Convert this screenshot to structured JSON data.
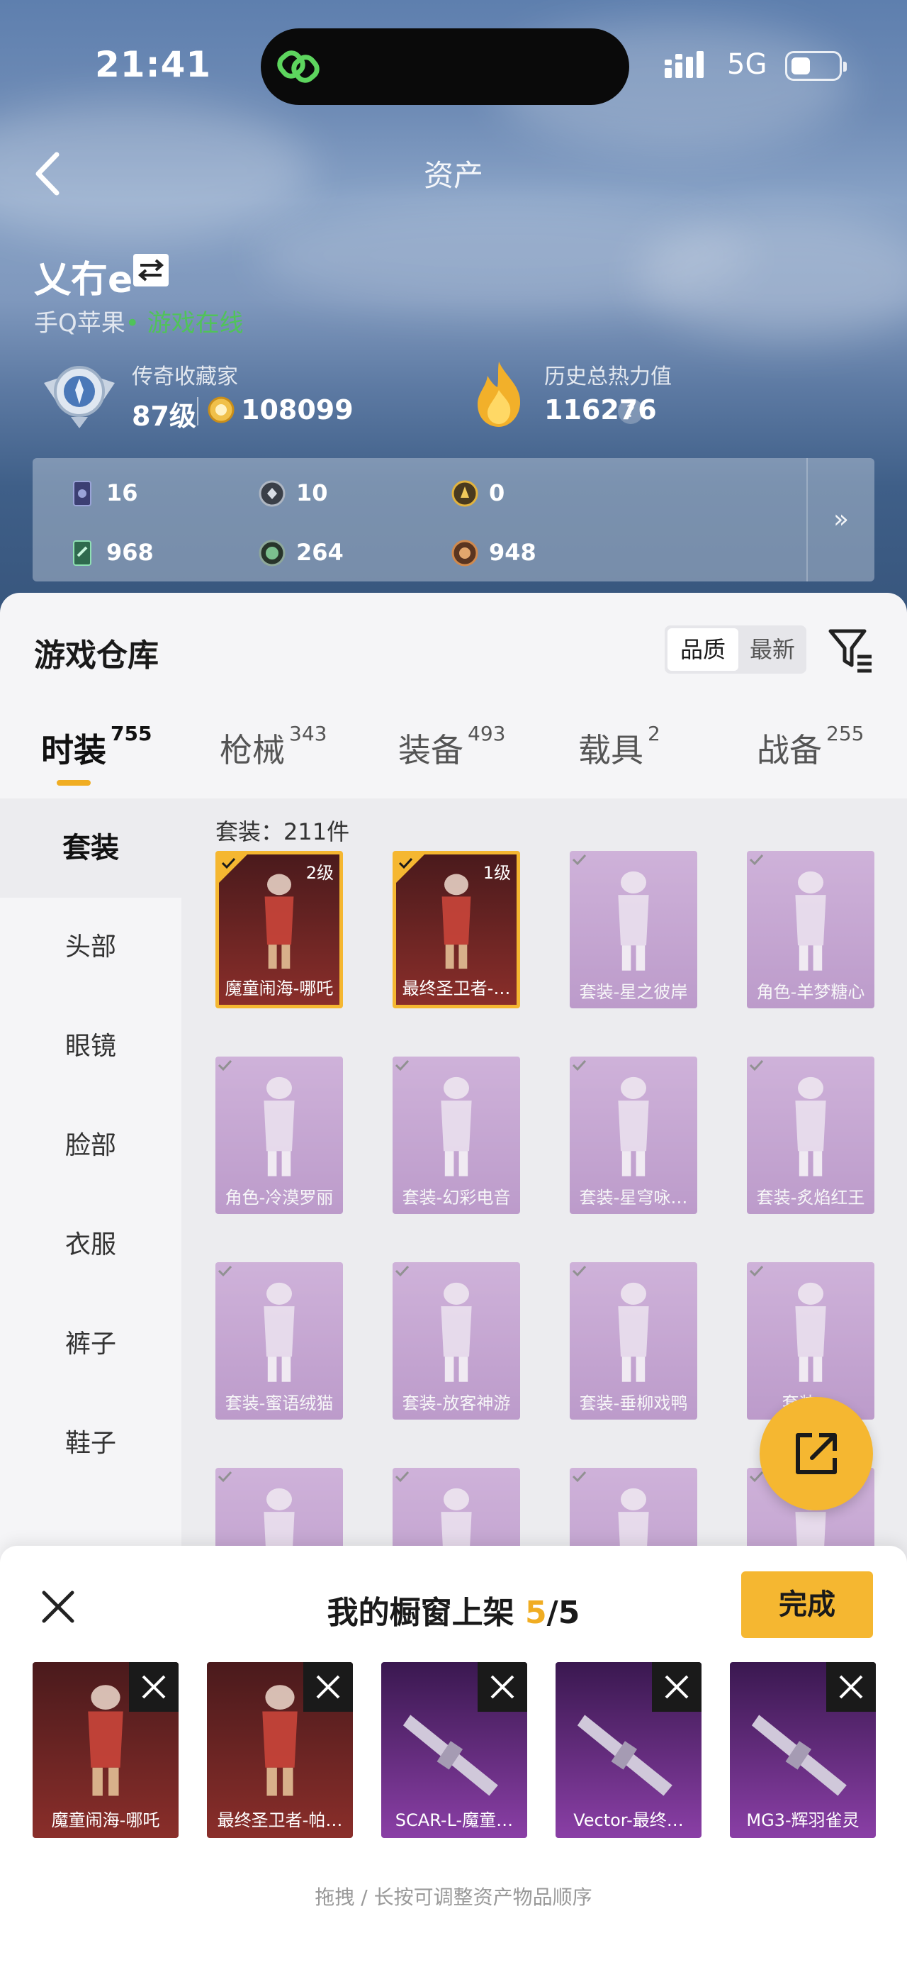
{
  "status_bar": {
    "time": "21:41",
    "network": "5G"
  },
  "header": {
    "title": "资产"
  },
  "profile": {
    "name": "乂冇e",
    "platform": "手Q苹果",
    "online_text": "• 游戏在线",
    "rank_label": "传奇收藏家",
    "level": "87级",
    "coins": "108099",
    "heat_label": "历史总热力值",
    "heat_value": "116276",
    "help": "?"
  },
  "stats": [
    {
      "icon": "card-icon",
      "value": "16"
    },
    {
      "icon": "silver-medal-icon",
      "value": "10"
    },
    {
      "icon": "gold-medal-icon",
      "value": "0"
    },
    {
      "icon": "voucher-icon",
      "value": "968"
    },
    {
      "icon": "orb-icon",
      "value": "264"
    },
    {
      "icon": "bronze-coin-icon",
      "value": "948"
    }
  ],
  "stats_more": "»",
  "warehouse": {
    "title": "游戏仓库",
    "sort": {
      "quality": "品质",
      "latest": "最新"
    },
    "tabs": [
      {
        "label": "时装",
        "count": "755"
      },
      {
        "label": "枪械",
        "count": "343"
      },
      {
        "label": "装备",
        "count": "493"
      },
      {
        "label": "载具",
        "count": "2"
      },
      {
        "label": "战备",
        "count": "255"
      }
    ],
    "categories": [
      "套装",
      "头部",
      "眼镜",
      "脸部",
      "衣服",
      "裤子",
      "鞋子"
    ],
    "count_text": "套装：211件",
    "items": [
      {
        "name": "魔童闹海-哪吒",
        "level": "2级",
        "selected": true,
        "rarity": "red"
      },
      {
        "name": "最终圣卫者-…",
        "level": "1级",
        "selected": true,
        "rarity": "red"
      },
      {
        "name": "套装-星之彼岸",
        "level": "",
        "selected": false,
        "rarity": "purple"
      },
      {
        "name": "角色-羊梦糖心",
        "level": "",
        "selected": false,
        "rarity": "purple"
      },
      {
        "name": "角色-冷漠罗丽",
        "level": "",
        "selected": false,
        "rarity": "purple"
      },
      {
        "name": "套装-幻彩电音",
        "level": "",
        "selected": false,
        "rarity": "purple"
      },
      {
        "name": "套装-星穹咏…",
        "level": "",
        "selected": false,
        "rarity": "purple"
      },
      {
        "name": "套装-炙焰红王",
        "level": "",
        "selected": false,
        "rarity": "purple"
      },
      {
        "name": "套装-蜜语绒猫",
        "level": "",
        "selected": false,
        "rarity": "purple"
      },
      {
        "name": "套装-放客神游",
        "level": "",
        "selected": false,
        "rarity": "purple"
      },
      {
        "name": "套装-垂柳戏鸭",
        "level": "",
        "selected": false,
        "rarity": "purple"
      },
      {
        "name": "套装-…",
        "level": "",
        "selected": false,
        "rarity": "purple"
      },
      {
        "name": "",
        "level": "",
        "selected": false,
        "rarity": "purple"
      },
      {
        "name": "",
        "level": "",
        "selected": false,
        "rarity": "purple"
      },
      {
        "name": "",
        "level": "",
        "selected": false,
        "rarity": "purple"
      },
      {
        "name": "",
        "level": "",
        "selected": false,
        "rarity": "purple"
      }
    ]
  },
  "showcase": {
    "title_prefix": "我的橱窗上架 ",
    "current": "5",
    "total": "/5",
    "done_label": "完成",
    "slots": [
      {
        "name": "魔童闹海-哪吒",
        "rarity": "red"
      },
      {
        "name": "最终圣卫者-帕…",
        "rarity": "red"
      },
      {
        "name": "SCAR-L-魔童…",
        "rarity": "purple"
      },
      {
        "name": "Vector-最终…",
        "rarity": "purple"
      },
      {
        "name": "MG3-辉羽雀灵",
        "rarity": "purple"
      }
    ],
    "hint": "拖拽 / 长按可调整资产物品顺序"
  },
  "colors": {
    "accent": "#f5b731",
    "online": "#50c35a",
    "red_rarity": "#7a2a2a",
    "purple_rarity": "#a771b8"
  }
}
